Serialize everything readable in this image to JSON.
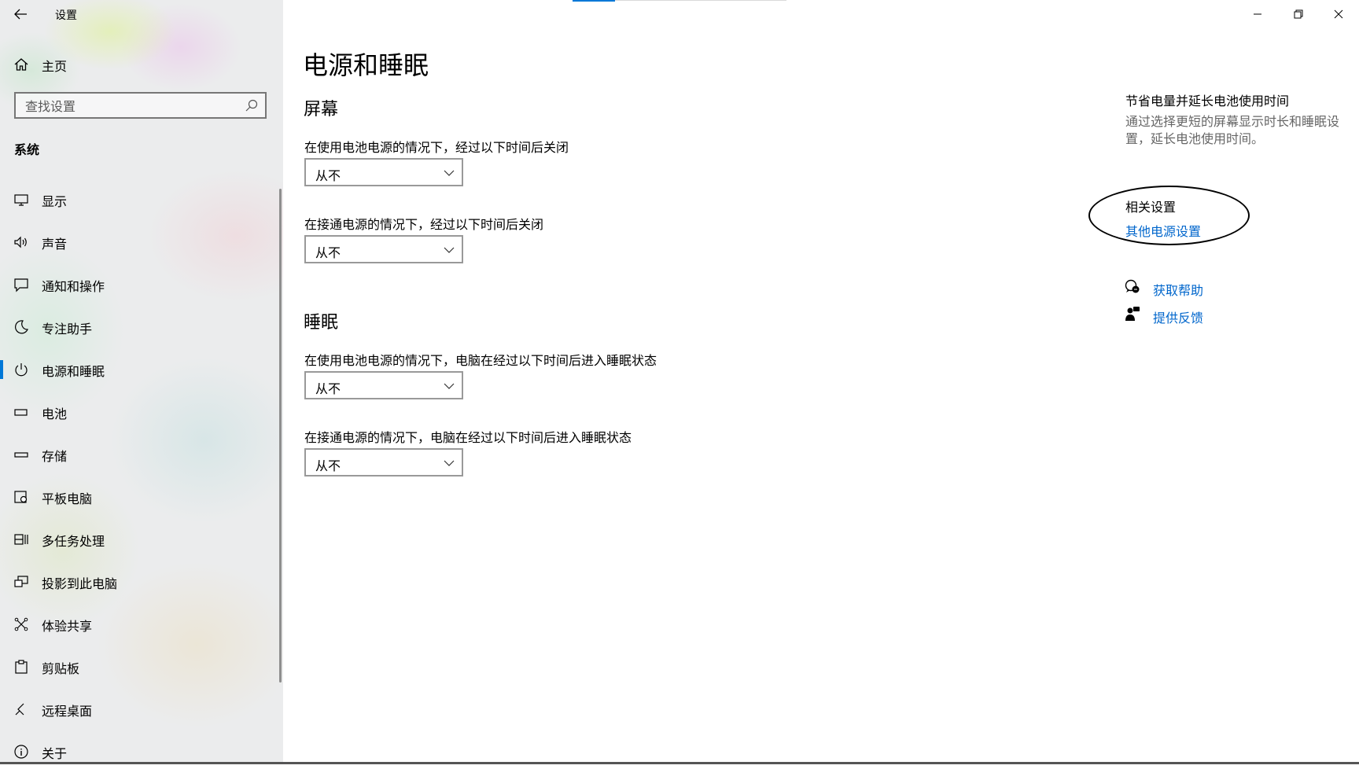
{
  "window": {
    "title": "设置",
    "controls": {
      "minimize": "minimize",
      "restore": "restore",
      "close": "close"
    }
  },
  "sidebar": {
    "home_label": "主页",
    "search": {
      "placeholder": "查找设置",
      "value": ""
    },
    "section": "系统",
    "items": [
      {
        "label": "显示",
        "icon": "monitor-icon"
      },
      {
        "label": "声音",
        "icon": "speaker-icon"
      },
      {
        "label": "通知和操作",
        "icon": "notification-icon"
      },
      {
        "label": "专注助手",
        "icon": "moon-icon"
      },
      {
        "label": "电源和睡眠",
        "icon": "power-icon",
        "active": true
      },
      {
        "label": "电池",
        "icon": "battery-icon"
      },
      {
        "label": "存储",
        "icon": "storage-icon"
      },
      {
        "label": "平板电脑",
        "icon": "tablet-icon"
      },
      {
        "label": "多任务处理",
        "icon": "multitask-icon"
      },
      {
        "label": "投影到此电脑",
        "icon": "project-icon"
      },
      {
        "label": "体验共享",
        "icon": "share-icon"
      },
      {
        "label": "剪贴板",
        "icon": "clipboard-icon"
      },
      {
        "label": "远程桌面",
        "icon": "remote-icon"
      },
      {
        "label": "关于",
        "icon": "info-icon"
      }
    ]
  },
  "main": {
    "title": "电源和睡眠",
    "screen": {
      "heading": "屏幕",
      "battery_label": "在使用电池电源的情况下，经过以下时间后关闭",
      "battery_value": "从不",
      "plugged_label": "在接通电源的情况下，经过以下时间后关闭",
      "plugged_value": "从不"
    },
    "sleep": {
      "heading": "睡眠",
      "battery_label": "在使用电池电源的情况下，电脑在经过以下时间后进入睡眠状态",
      "battery_value": "从不",
      "plugged_label": "在接通电源的情况下，电脑在经过以下时间后进入睡眠状态",
      "plugged_value": "从不"
    }
  },
  "right_panel": {
    "tip_title": "节省电量并延长电池使用时间",
    "tip_desc": "通过选择更短的屏幕显示时长和睡眠设置，延长电池使用时间。",
    "related_heading": "相关设置",
    "related_link": "其他电源设置",
    "help_link": "获取帮助",
    "feedback_link": "提供反馈"
  },
  "colors": {
    "accent": "#0078d7",
    "link": "#0066cc"
  }
}
